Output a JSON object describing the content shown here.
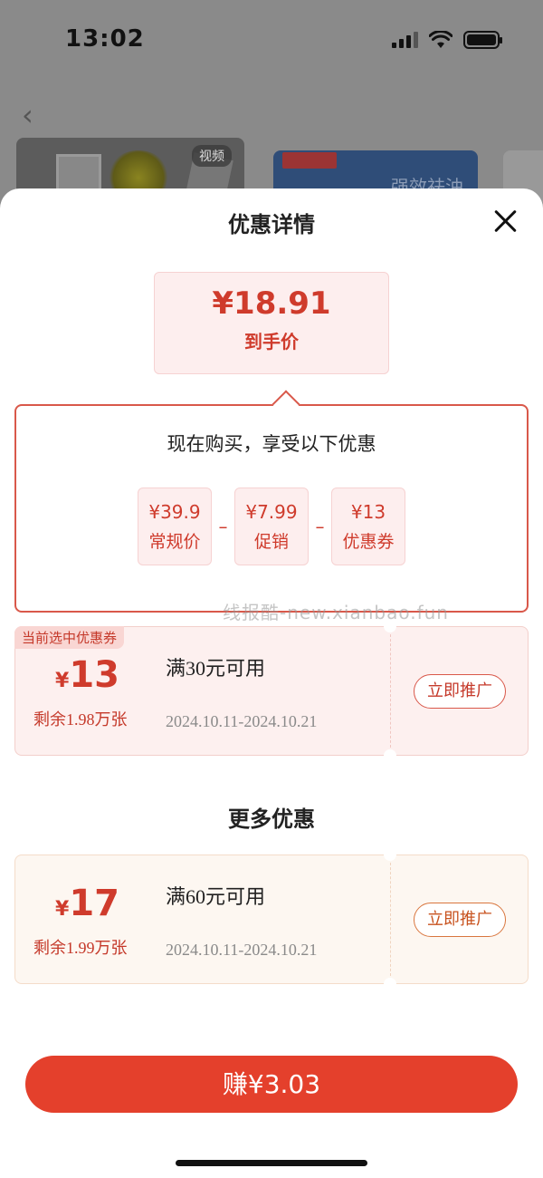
{
  "status_bar": {
    "time": "13:02"
  },
  "background": {
    "video_tag": "视频",
    "banner_text": "强效祛油"
  },
  "sheet": {
    "title": "优惠详情",
    "final_price": "¥18.91",
    "final_price_label": "到手价",
    "breakdown": {
      "title": "现在购买，享受以下优惠",
      "items": [
        {
          "value": "¥39.9",
          "label": "常规价"
        },
        {
          "value": "¥7.99",
          "label": "促销"
        },
        {
          "value": "¥13",
          "label": "优惠券"
        }
      ],
      "operator": "–"
    },
    "watermark": "线报酷-new.xianbao.fun",
    "current_coupon": {
      "tag": "当前选中优惠券",
      "currency": "¥",
      "amount": "13",
      "remaining": "剩余1.98万张",
      "condition": "满30元可用",
      "date_range": "2024.10.11-2024.10.21",
      "button": "立即推广"
    },
    "more_title": "更多优惠",
    "more_coupons": [
      {
        "currency": "¥",
        "amount": "17",
        "remaining": "剩余1.99万张",
        "condition": "满60元可用",
        "date_range": "2024.10.11-2024.10.21",
        "button": "立即推广"
      }
    ],
    "earn_button": "赚¥3.03"
  },
  "colors": {
    "accent": "#e4402c",
    "price_red": "#cf3b2c"
  }
}
